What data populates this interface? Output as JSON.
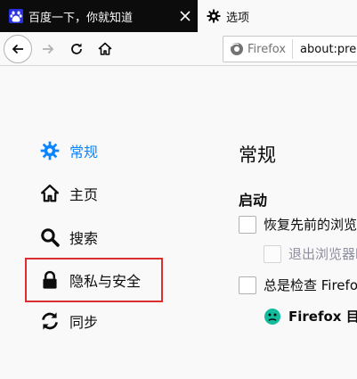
{
  "tabs": [
    {
      "title": "百度一下，你就知道",
      "favicon": "baidu-paw-icon",
      "active": false
    },
    {
      "title": "选项",
      "favicon": "gear-icon",
      "active": true
    }
  ],
  "toolbar": {
    "url_brand": "Firefox",
    "url_text": "about:pre"
  },
  "sidebar": {
    "items": [
      {
        "label": "常规",
        "icon": "gear-icon",
        "selected": true
      },
      {
        "label": "主页",
        "icon": "home-icon",
        "selected": false
      },
      {
        "label": "搜索",
        "icon": "search-icon",
        "selected": false
      },
      {
        "label": "隐私与安全",
        "icon": "lock-icon",
        "selected": false
      },
      {
        "label": "同步",
        "icon": "sync-icon",
        "selected": false
      }
    ]
  },
  "main": {
    "title": "常规",
    "startup": {
      "heading": "启动",
      "restore_label": "恢复先前的浏览",
      "warn_quit_label": "退出浏览器时",
      "default_check_label": "总是检查 Firefox",
      "status_label": "Firefox 目前"
    }
  },
  "colors": {
    "accent": "#0a84ff",
    "highlight": "#d92f2f",
    "tabstrip": "#0c0c0d"
  }
}
